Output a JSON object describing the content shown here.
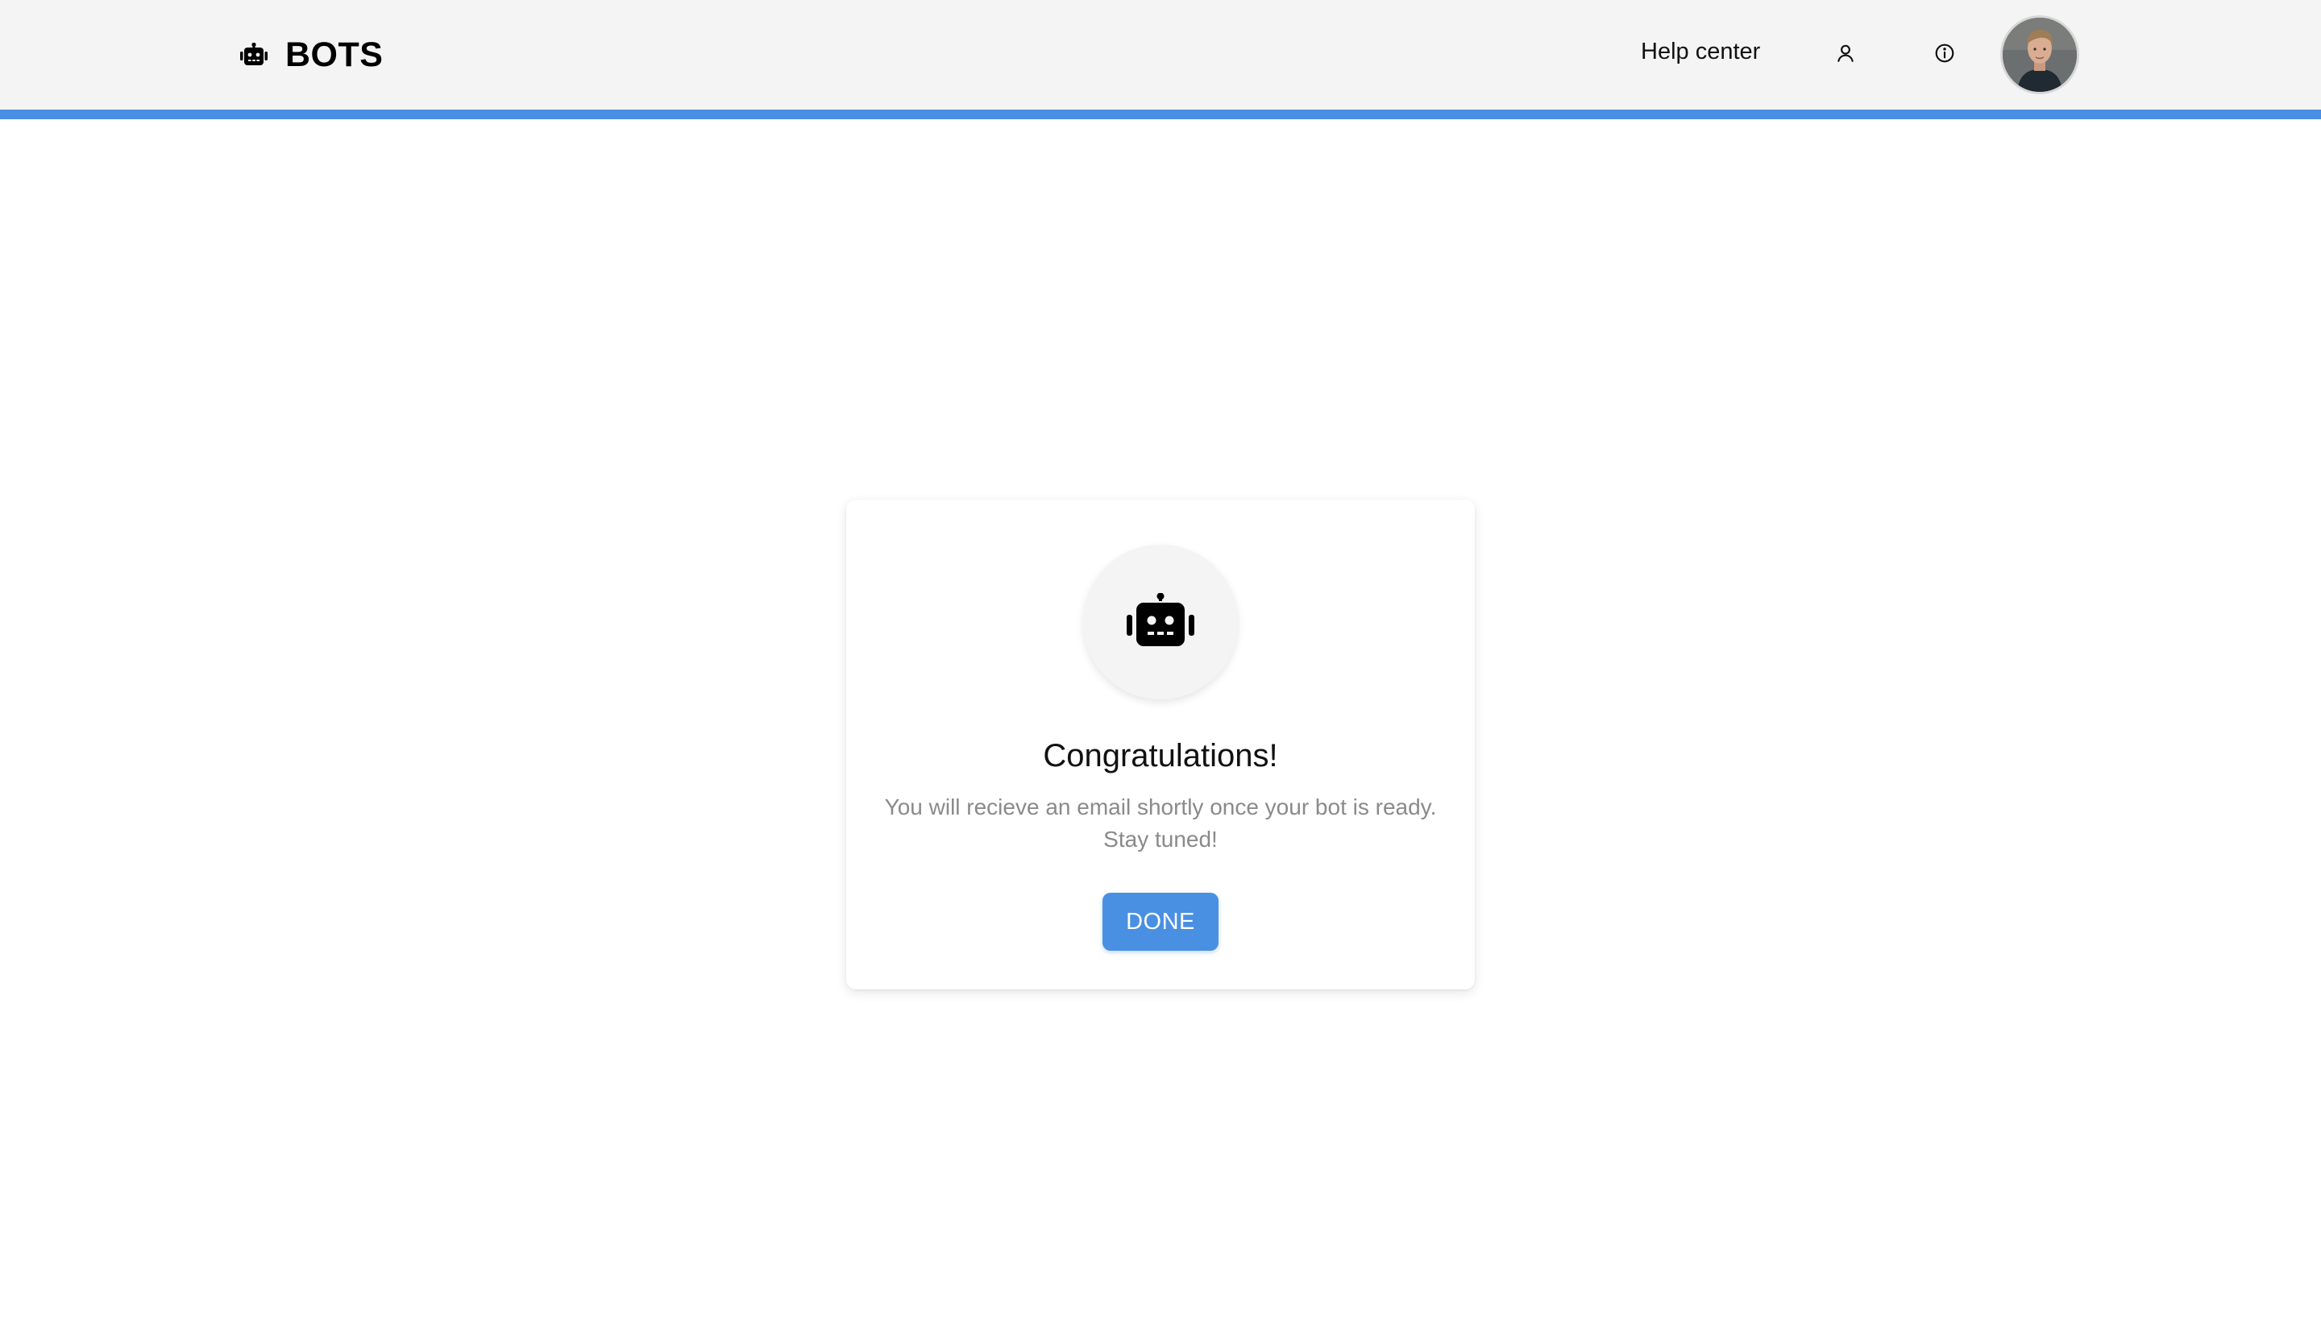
{
  "header": {
    "brand": {
      "name": "BOTS",
      "icon": "robot-icon"
    },
    "nav": {
      "help_label": "Help center"
    },
    "icons": {
      "user": "user-icon",
      "info": "info-icon",
      "avatar": "avatar"
    }
  },
  "progress": {
    "value_percent": 100,
    "color": "#4a90e2"
  },
  "card": {
    "icon": "robot-icon",
    "title": "Congratulations!",
    "message_line1": "You will recieve an email shortly once your bot is ready.",
    "message_line2": "Stay tuned!",
    "done_label": "DONE"
  },
  "colors": {
    "accent": "#4a90e2",
    "header_bg": "#f4f4f4",
    "muted_text": "#8a8a8a"
  }
}
